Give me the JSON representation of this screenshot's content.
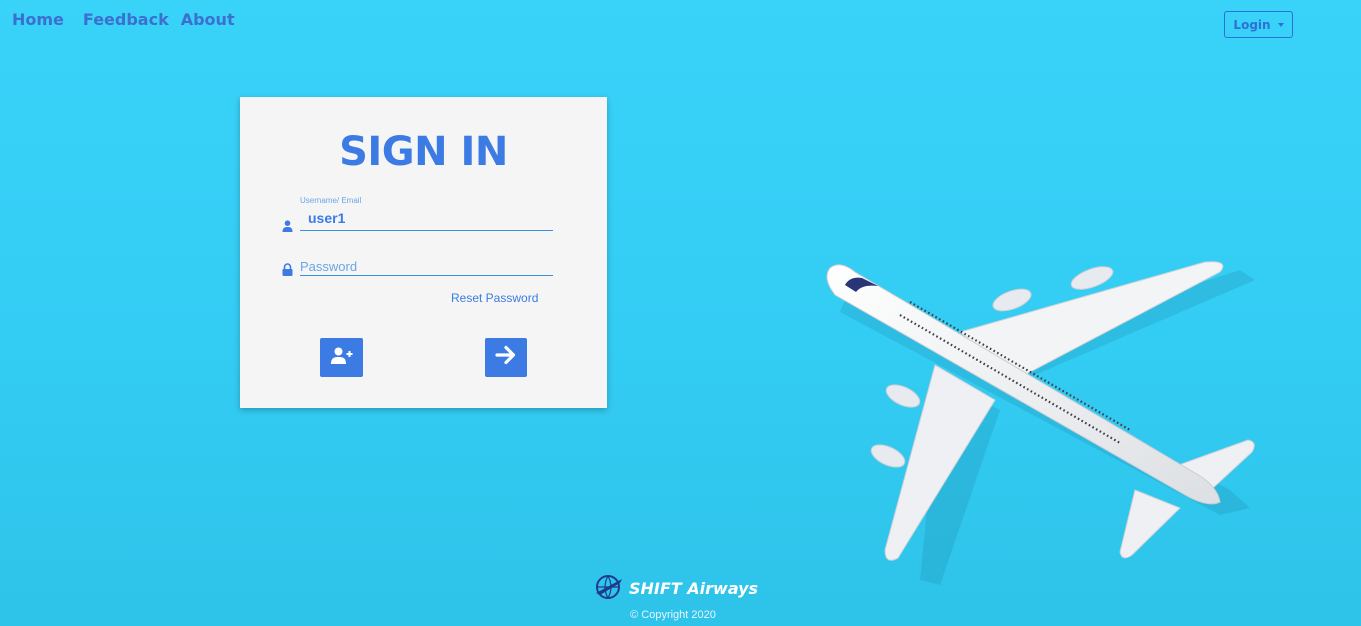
{
  "nav": {
    "home": "Home",
    "feedback": "Feedback",
    "about": "About"
  },
  "login_menu": {
    "label": "Login"
  },
  "signin": {
    "title": "SIGN IN",
    "username_label": "Username/ Email",
    "username_value": "user1",
    "password_placeholder": "Password",
    "reset_link": "Reset Password"
  },
  "footer": {
    "brand": "SHIFT Airways",
    "copyright": "© Copyright 2020"
  },
  "colors": {
    "background": "#33ccf3",
    "accent": "#3c7be4",
    "card": "#f5f5f5"
  },
  "icons": {
    "user": "user-icon",
    "lock": "lock-icon",
    "register": "add-user-icon",
    "submit": "arrow-right-icon",
    "logo": "plane-globe-icon"
  }
}
